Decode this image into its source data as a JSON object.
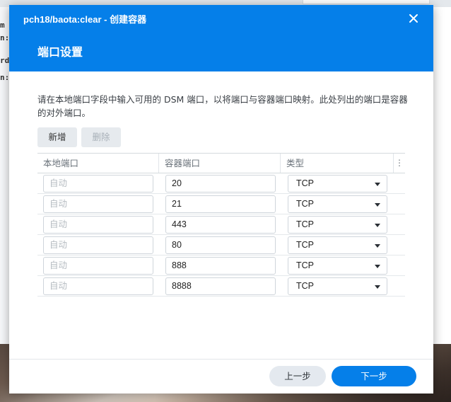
{
  "background": {
    "left_fragments": [
      "m",
      "n:c",
      "rd",
      "n:c"
    ]
  },
  "dialog": {
    "title": "pch18/baota:clear - 创建容器",
    "close_icon": "close-icon",
    "heading": "端口设置",
    "description": "请在本地端口字段中输入可用的 DSM 端口，以将端口与容器端口映射。此处列出的端口是容器的对外端口。",
    "add_label": "新增",
    "delete_label": "删除",
    "table": {
      "columns": [
        "本地端口",
        "容器端口",
        "类型"
      ],
      "menu_icon": "more-vertical-icon",
      "rows": [
        {
          "local_placeholder": "自动",
          "container_port": "20",
          "type": "TCP"
        },
        {
          "local_placeholder": "自动",
          "container_port": "21",
          "type": "TCP"
        },
        {
          "local_placeholder": "自动",
          "container_port": "443",
          "type": "TCP"
        },
        {
          "local_placeholder": "自动",
          "container_port": "80",
          "type": "TCP"
        },
        {
          "local_placeholder": "自动",
          "container_port": "888",
          "type": "TCP"
        },
        {
          "local_placeholder": "自动",
          "container_port": "8888",
          "type": "TCP"
        }
      ]
    },
    "prev_label": "上一步",
    "next_label": "下一步"
  },
  "colors": {
    "accent": "#057fe9",
    "header_bg": "#057fe9",
    "secondary_button_bg": "#e4e9ef"
  }
}
